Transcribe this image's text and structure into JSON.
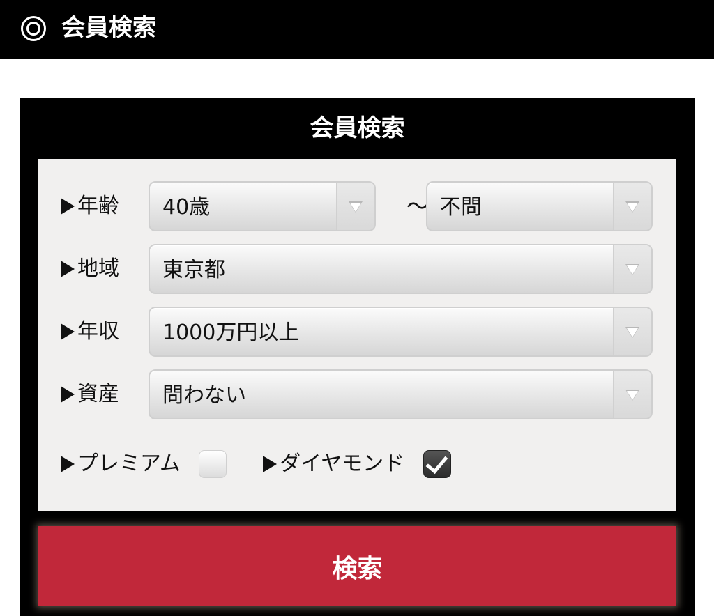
{
  "header": {
    "title": "会員検索",
    "icon": "double-circle-icon"
  },
  "panel": {
    "title": "会員検索",
    "age": {
      "label": "年齢",
      "from": "40歳",
      "separator": "〜",
      "to": "不問"
    },
    "region": {
      "label": "地域",
      "value": "東京都"
    },
    "income": {
      "label": "年収",
      "value": "1000万円以上"
    },
    "assets": {
      "label": "資産",
      "value": "問わない"
    },
    "premium": {
      "label": "プレミアム",
      "checked": false
    },
    "diamond": {
      "label": "ダイヤモンド",
      "checked": true
    },
    "search_label": "検索"
  },
  "colors": {
    "header_bg": "#000000",
    "panel_bg": "#000000",
    "form_bg": "#f1f0ef",
    "search_button": "#c1283a"
  }
}
